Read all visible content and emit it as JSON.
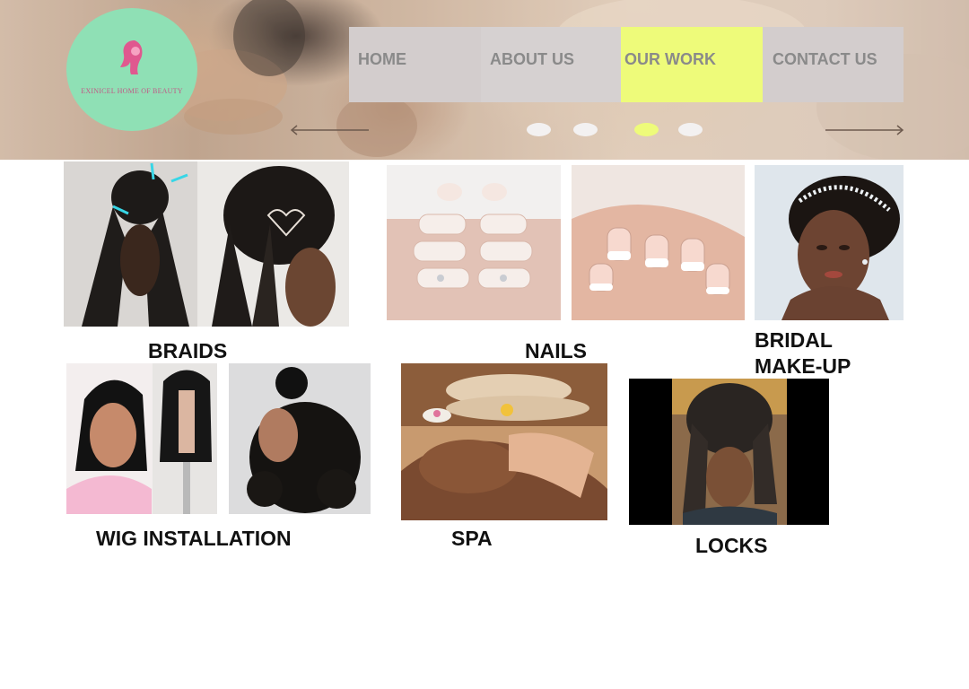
{
  "colors": {
    "nav_bg": "#d3cdcd",
    "nav_active": "#eefb7a",
    "logo_bg": "#8fe0b5",
    "logo_accent": "#e0588f",
    "nav_text": "#8a8a8a",
    "caption_text": "#111111"
  },
  "logo": {
    "text": "EXINICEL HOME OF BEAUTY",
    "icon": "woman-silhouette-icon"
  },
  "nav": {
    "items": [
      {
        "label": "HOME",
        "active": false
      },
      {
        "label": "ABOUT US",
        "active": false
      },
      {
        "label": "OUR WORK",
        "active": true
      },
      {
        "label": "CONTACT US",
        "active": false
      }
    ]
  },
  "carousel": {
    "prev_icon": "arrow-left-icon",
    "next_icon": "arrow-right-icon",
    "slide_count": 4,
    "active_slide": 3
  },
  "gallery": {
    "braids": {
      "caption": "BRAIDS"
    },
    "nails": {
      "caption": "NAILS"
    },
    "bridal": {
      "caption_line1": "BRIDAL",
      "caption_line2": "MAKE-UP"
    },
    "wig": {
      "caption": "WIG INSTALLATION"
    },
    "spa": {
      "caption": "SPA"
    },
    "locks": {
      "caption": "LOCKS"
    }
  }
}
